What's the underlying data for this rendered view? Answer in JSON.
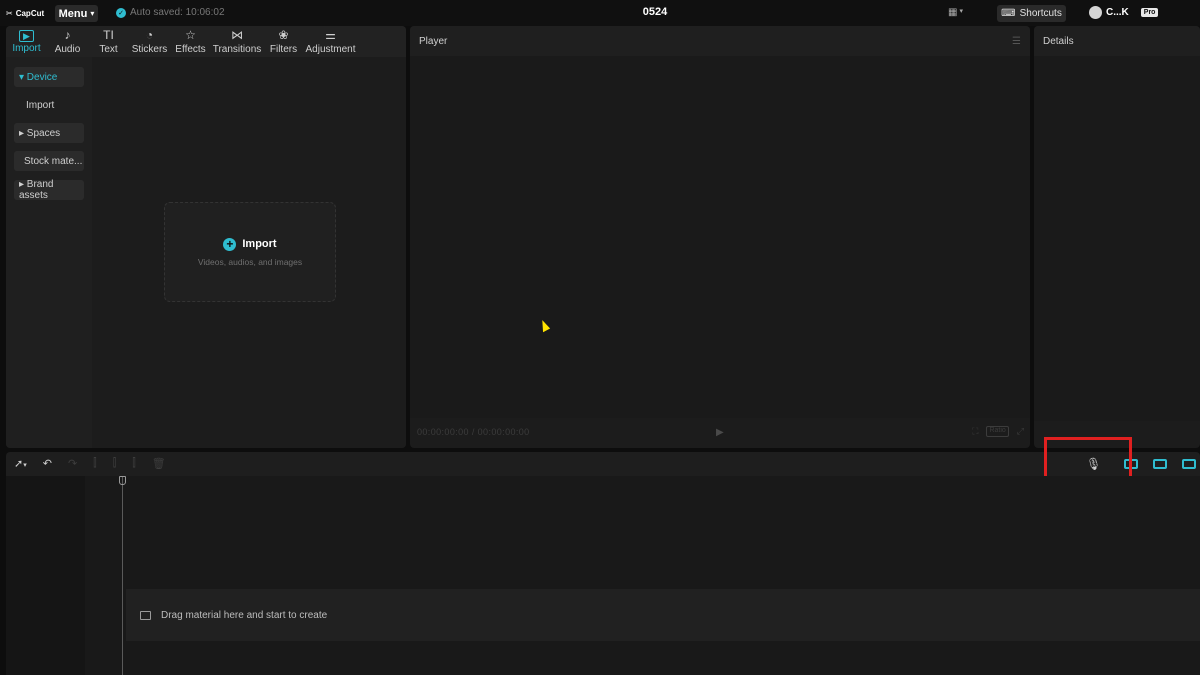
{
  "titlebar": {
    "app_name": "CapCut",
    "menu_label": "Menu",
    "autosave_text": "Auto saved: 10:06:02",
    "project_name": "0524",
    "shortcuts_label": "Shortcuts",
    "user_name": "C...K",
    "badge": "Pro"
  },
  "tools": [
    {
      "label": "Import",
      "icon": "import-icon",
      "glyph": "▶"
    },
    {
      "label": "Audio",
      "icon": "audio-icon",
      "glyph": "♪"
    },
    {
      "label": "Text",
      "icon": "text-icon",
      "glyph": "TI"
    },
    {
      "label": "Stickers",
      "icon": "stickers-icon",
      "glyph": "◔"
    },
    {
      "label": "Effects",
      "icon": "effects-icon",
      "glyph": "☆"
    },
    {
      "label": "Transitions",
      "icon": "transitions-icon",
      "glyph": "⋈"
    },
    {
      "label": "Filters",
      "icon": "filters-icon",
      "glyph": "❀"
    },
    {
      "label": "Adjustment",
      "icon": "adjustment-icon",
      "glyph": "⚌"
    }
  ],
  "sidebar": {
    "items": [
      {
        "label": "▾ Device"
      },
      {
        "label": "Import"
      },
      {
        "label": "▸ Spaces"
      },
      {
        "label": "Stock mate..."
      },
      {
        "label": "▸ Brand assets"
      }
    ]
  },
  "media": {
    "import_title": "Import",
    "import_subtitle": "Videos, audios, and images"
  },
  "player": {
    "title": "Player",
    "timecode": "00:00:00:00 / 00:00:00:00",
    "ratio_label": "Ratio"
  },
  "details": {
    "title": "Details"
  },
  "timeline": {
    "drop_hint": "Drag material here and start to create"
  },
  "colors": {
    "accent": "#2fbdd0",
    "highlight": "#e02020",
    "background": "#0d0d0d",
    "panel": "#1c1c1c"
  }
}
